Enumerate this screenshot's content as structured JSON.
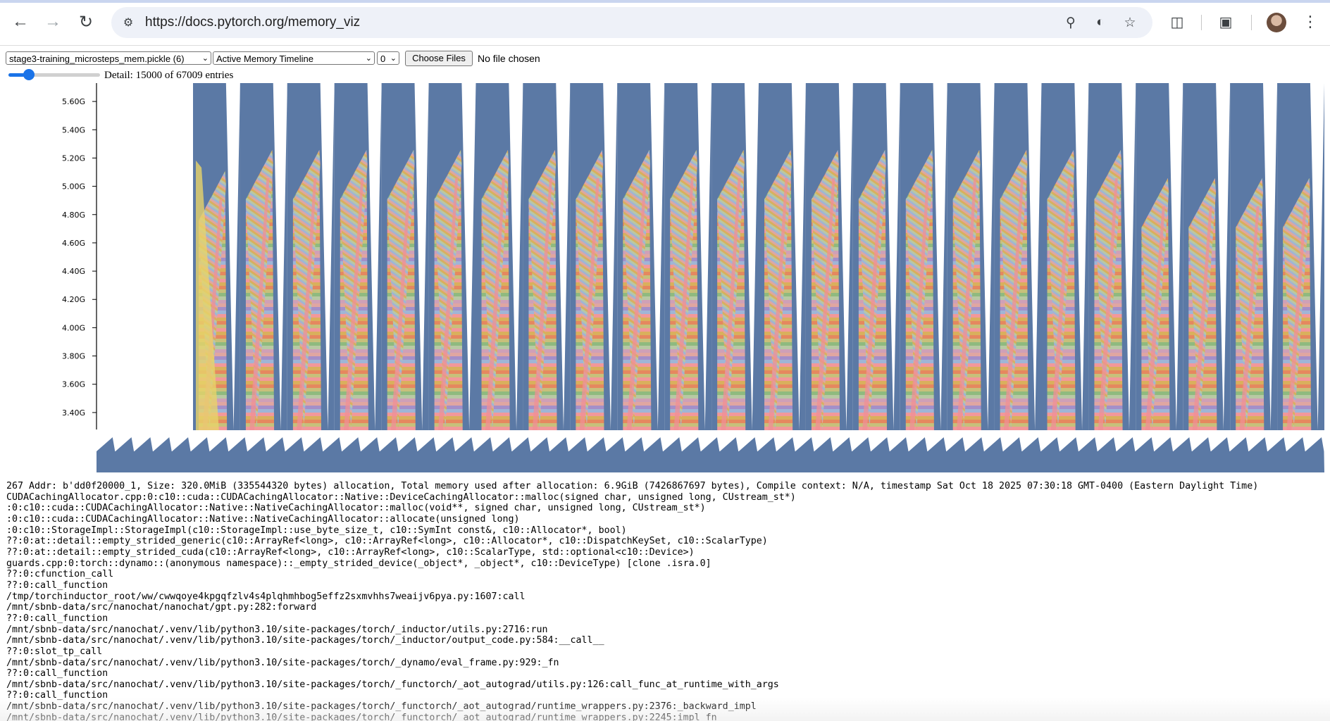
{
  "browser": {
    "url": "https://docs.pytorch.org/memory_viz",
    "icons": [
      "back-icon",
      "forward-icon",
      "reload-icon",
      "site-settings-icon",
      "zoom-icon",
      "performance-icon",
      "bookmark-star-icon",
      "extensions-icon",
      "tab-search-icon",
      "avatar",
      "more-menu-icon"
    ]
  },
  "controls": {
    "snapshot_select": "stage3-training_microsteps_mem.pickle (6)",
    "view_select": "Active Memory Timeline",
    "device_select": "0",
    "choose_files_label": "Choose Files",
    "file_status": "No file chosen",
    "detail_text": "Detail: 15000 of 67009 entries",
    "detail_slider_fraction": 0.22
  },
  "chart_data": {
    "type": "area",
    "yticks": [
      "5.60G",
      "5.40G",
      "5.20G",
      "5.00G",
      "4.80G",
      "4.60G",
      "4.40G",
      "4.20G",
      "4.00G",
      "3.80G",
      "3.60G",
      "3.40G"
    ],
    "ylim_gb": [
      3.28,
      5.73
    ],
    "cycles": 24,
    "minimap_teeth": 65,
    "colors": {
      "background_memory": "#5b79a5",
      "stripes": [
        "#f2989a",
        "#e0a6a1",
        "#8fba7f",
        "#d9b05c",
        "#a48fc9",
        "#b8c9a4",
        "#e5885f",
        "#9fb5d6",
        "#cfa0b7",
        "#c7c07b"
      ]
    }
  },
  "trace_lines": [
    "267 Addr: b'dd0f20000_1, Size: 320.0MiB (335544320 bytes) allocation, Total memory used after allocation: 6.9GiB (7426867697 bytes), Compile context: N/A, timestamp Sat Oct 18 2025 07:30:18 GMT-0400 (Eastern Daylight Time)",
    "CUDACachingAllocator.cpp:0:c10::cuda::CUDACachingAllocator::Native::DeviceCachingAllocator::malloc(signed char, unsigned long, CUstream_st*)",
    ":0:c10::cuda::CUDACachingAllocator::Native::NativeCachingAllocator::malloc(void**, signed char, unsigned long, CUstream_st*)",
    ":0:c10::cuda::CUDACachingAllocator::Native::NativeCachingAllocator::allocate(unsigned long)",
    ":0:c10::StorageImpl::StorageImpl(c10::StorageImpl::use_byte_size_t, c10::SymInt const&, c10::Allocator*, bool)",
    "??:0:at::detail::empty_strided_generic(c10::ArrayRef<long>, c10::ArrayRef<long>, c10::Allocator*, c10::DispatchKeySet, c10::ScalarType)",
    "??:0:at::detail::empty_strided_cuda(c10::ArrayRef<long>, c10::ArrayRef<long>, c10::ScalarType, std::optional<c10::Device>)",
    "guards.cpp:0:torch::dynamo::(anonymous namespace)::_empty_strided_device(_object*, _object*, c10::DeviceType) [clone .isra.0]",
    "??:0:cfunction_call",
    "??:0:call_function",
    "/tmp/torchinductor_root/ww/cwwqoye4kpgqfzlv4s4plqhmhbog5effz2sxmvhhs7weaijv6pya.py:1607:call",
    "/mnt/sbnb-data/src/nanochat/nanochat/gpt.py:282:forward",
    "??:0:call_function",
    "/mnt/sbnb-data/src/nanochat/.venv/lib/python3.10/site-packages/torch/_inductor/utils.py:2716:run",
    "/mnt/sbnb-data/src/nanochat/.venv/lib/python3.10/site-packages/torch/_inductor/output_code.py:584:__call__",
    "??:0:slot_tp_call",
    "/mnt/sbnb-data/src/nanochat/.venv/lib/python3.10/site-packages/torch/_dynamo/eval_frame.py:929:_fn",
    "??:0:call_function",
    "/mnt/sbnb-data/src/nanochat/.venv/lib/python3.10/site-packages/torch/_functorch/_aot_autograd/utils.py:126:call_func_at_runtime_with_args",
    "??:0:call_function",
    "/mnt/sbnb-data/src/nanochat/.venv/lib/python3.10/site-packages/torch/_functorch/_aot_autograd/runtime_wrappers.py:2376:_backward_impl",
    "/mnt/sbnb-data/src/nanochat/.venv/lib/python3.10/site-packages/torch/_functorch/_aot_autograd/runtime_wrappers.py:2245:impl_fn"
  ]
}
